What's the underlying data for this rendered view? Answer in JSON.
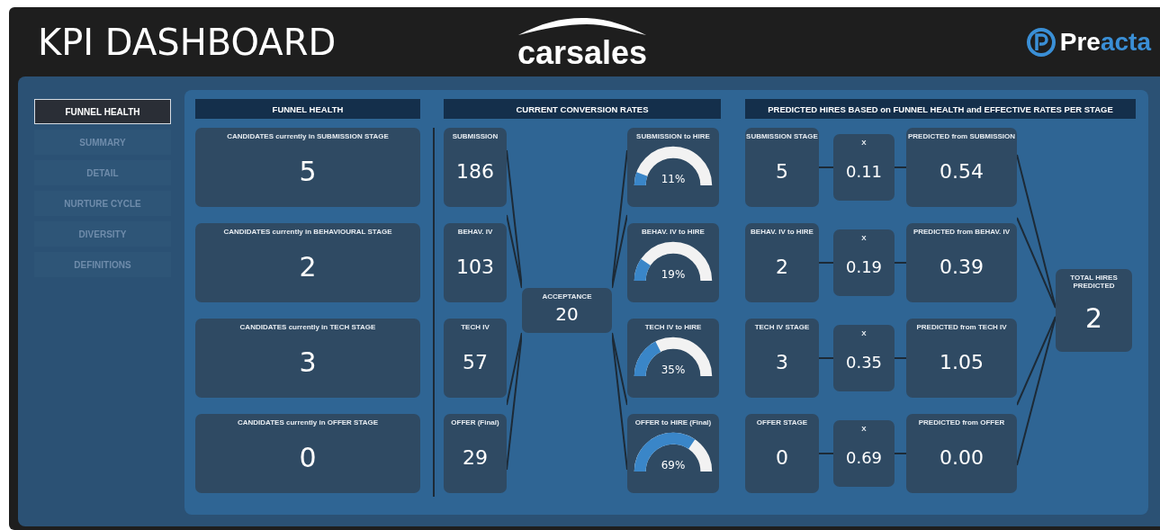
{
  "header": {
    "title": "KPI DASHBOARD",
    "logos": [
      {
        "kind": "carsales",
        "parts": [
          {
            "text": "carsales"
          }
        ]
      },
      {
        "kind": "preacta",
        "parts": [
          {
            "text": "Pre",
            "color": "#ffffff"
          },
          {
            "text": "acta",
            "color": "#3a8fd6"
          }
        ]
      }
    ]
  },
  "nav": [
    {
      "label": "FUNNEL HEALTH",
      "selected": true
    },
    {
      "label": "SUMMARY",
      "selected": false
    },
    {
      "label": "DETAIL",
      "selected": false
    },
    {
      "label": "NURTURE CYCLE",
      "selected": false
    },
    {
      "label": "DIVERSITY",
      "selected": false
    },
    {
      "label": "DEFINITIONS",
      "selected": false
    }
  ],
  "funnel_health": {
    "title": "FUNNEL HEALTH",
    "cards": [
      {
        "label": "CANDIDATES currently in SUBMISSION STAGE",
        "value": "5"
      },
      {
        "label": "CANDIDATES currently in BEHAVIOURAL STAGE",
        "value": "2"
      },
      {
        "label": "CANDIDATES currently in TECH STAGE",
        "value": "3"
      },
      {
        "label": "CANDIDATES currently in OFFER STAGE",
        "value": "0"
      }
    ]
  },
  "conversion": {
    "title": "CURRENT CONVERSION RATES",
    "stages": [
      {
        "label": "SUBMISSION",
        "value": "186"
      },
      {
        "label": "BEHAV. IV",
        "value": "103"
      },
      {
        "label": "TECH IV",
        "value": "57"
      },
      {
        "label": "OFFER (Final)",
        "value": "29"
      }
    ],
    "acceptance": {
      "label": "ACCEPTANCE",
      "value": "20"
    },
    "rates": [
      {
        "label": "SUBMISSION to HIRE",
        "reading": "11%"
      },
      {
        "label": "BEHAV. IV to HIRE",
        "reading": "19%"
      },
      {
        "label": "TECH IV to HIRE",
        "reading": "35%"
      },
      {
        "label": "OFFER to HIRE (Final)",
        "reading": "69%"
      }
    ]
  },
  "predicted": {
    "title": "PREDICTED HIRES BASED on FUNNEL HEALTH  and EFFECTIVE RATES PER STAGE",
    "rows": [
      {
        "stage_label": "SUBMISSION STAGE",
        "stage_value": "5",
        "factor_label": "X",
        "factor_value": "0.11",
        "predicted_label": "PREDICTED from SUBMISSION",
        "predicted_value": "0.54"
      },
      {
        "stage_label": "BEHAV. IV to HIRE",
        "stage_value": "2",
        "factor_label": "X",
        "factor_value": "0.19",
        "predicted_label": "PREDICTED from BEHAV. IV",
        "predicted_value": "0.39"
      },
      {
        "stage_label": "TECH IV STAGE",
        "stage_value": "3",
        "factor_label": "X",
        "factor_value": "0.35",
        "predicted_label": "PREDICTED from TECH IV",
        "predicted_value": "1.05"
      },
      {
        "stage_label": "OFFER STAGE",
        "stage_value": "0",
        "factor_label": "X",
        "factor_value": "0.69",
        "predicted_label": "PREDICTED from OFFER",
        "predicted_value": "0.00"
      }
    ],
    "total": {
      "label": "TOTAL HIRES PREDICTED",
      "value": "2"
    }
  }
}
